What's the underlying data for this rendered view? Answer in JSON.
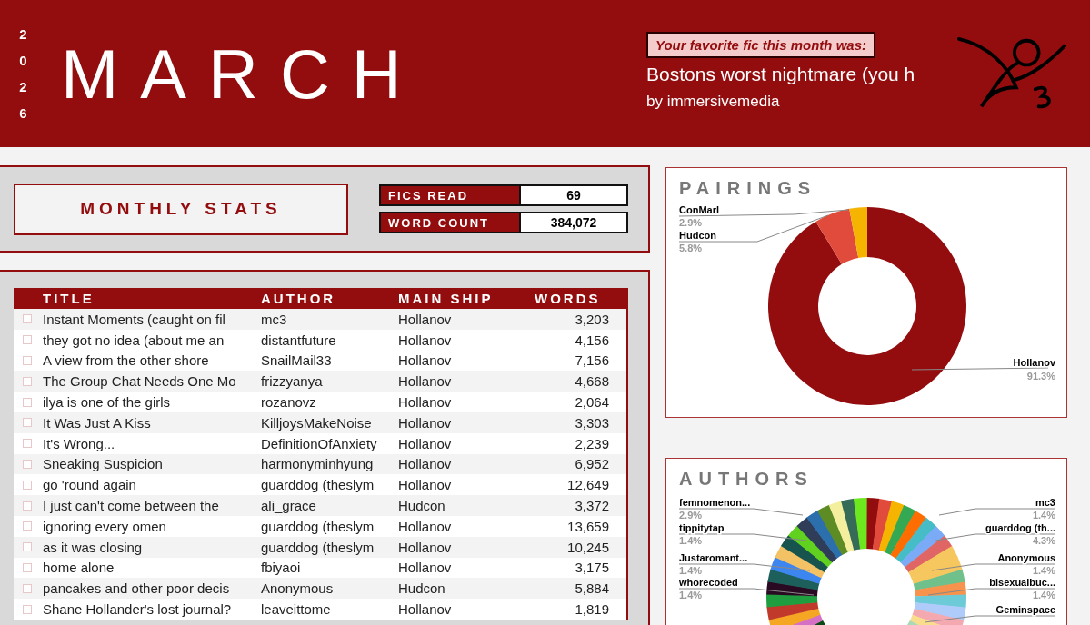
{
  "header": {
    "year": "2026",
    "month": "MARCH",
    "favorite": {
      "prompt": "Your favorite fic this month was:",
      "title": "Bostons worst nightmare (you h",
      "byline": "by immersivemedia"
    }
  },
  "stats": {
    "heading": "MONTHLY STATS",
    "items": [
      {
        "label": "FICS READ",
        "value": "69"
      },
      {
        "label": "WORD COUNT",
        "value": "384,072"
      }
    ]
  },
  "table": {
    "columns": [
      "TITLE",
      "AUTHOR",
      "MAIN SHIP",
      "WORDS"
    ],
    "rows": [
      {
        "checked": false,
        "title": "Instant Moments (caught on fil",
        "author": "mc3",
        "ship": "Hollanov",
        "words": "3,203"
      },
      {
        "checked": false,
        "title": "they got no idea (about me an",
        "author": "distantfuture",
        "ship": "Hollanov",
        "words": "4,156"
      },
      {
        "checked": false,
        "title": "A view from the other shore",
        "author": "SnailMail33",
        "ship": "Hollanov",
        "words": "7,156"
      },
      {
        "checked": false,
        "title": "The Group Chat Needs One Mo",
        "author": "frizzyanya",
        "ship": "Hollanov",
        "words": "4,668"
      },
      {
        "checked": false,
        "title": "ilya is one of the girls",
        "author": "rozanovz",
        "ship": "Hollanov",
        "words": "2,064"
      },
      {
        "checked": false,
        "title": "It Was Just A Kiss",
        "author": "KilljoysMakeNoise",
        "ship": "Hollanov",
        "words": "3,303"
      },
      {
        "checked": false,
        "title": "It's Wrong...",
        "author": "DefinitionOfAnxiety",
        "ship": "Hollanov",
        "words": "2,239"
      },
      {
        "checked": false,
        "title": "Sneaking Suspicion",
        "author": "harmonyminhyung",
        "ship": "Hollanov",
        "words": "6,952"
      },
      {
        "checked": false,
        "title": "go 'round again",
        "author": "guarddog (theslym",
        "ship": "Hollanov",
        "words": "12,649"
      },
      {
        "checked": false,
        "title": "I just can't come between the",
        "author": "ali_grace",
        "ship": "Hudcon",
        "words": "3,372"
      },
      {
        "checked": false,
        "title": "ignoring every omen",
        "author": "guarddog (theslym",
        "ship": "Hollanov",
        "words": "13,659"
      },
      {
        "checked": false,
        "title": "as it was closing",
        "author": "guarddog (theslym",
        "ship": "Hollanov",
        "words": "10,245"
      },
      {
        "checked": false,
        "title": "home alone",
        "author": "fbiyaoi",
        "ship": "Hollanov",
        "words": "3,175"
      },
      {
        "checked": false,
        "title": "pancakes and other poor decis",
        "author": "Anonymous",
        "ship": "Hudcon",
        "words": "5,884"
      },
      {
        "checked": false,
        "title": "Shane Hollander's lost journal?",
        "author": "leaveittome",
        "ship": "Hollanov",
        "words": "1,819"
      }
    ]
  },
  "pairings": {
    "chart_data": {
      "type": "donut",
      "title": "PAIRINGS",
      "categories": [
        "Hollanov",
        "Hudcon",
        "ConMarl"
      ],
      "values": [
        91.3,
        5.8,
        2.9
      ],
      "value_labels": [
        "91.3%",
        "5.8%",
        "2.9%"
      ]
    }
  },
  "authors": {
    "title": "AUTHORS",
    "left_labels": [
      {
        "name": "femnomenon...",
        "percent": "2.9%"
      },
      {
        "name": "tippitytap",
        "percent": "1.4%"
      },
      {
        "name": "Justaromant...",
        "percent": "1.4%"
      },
      {
        "name": "whorecoded",
        "percent": "1.4%"
      }
    ],
    "right_labels": [
      {
        "name": "mc3",
        "percent": "1.4%"
      },
      {
        "name": "guarddog (th...",
        "percent": "4.3%"
      },
      {
        "name": "Anonymous",
        "percent": "1.4%"
      },
      {
        "name": "bisexualbuc...",
        "percent": "1.4%"
      },
      {
        "name": "Geminspace"
      }
    ]
  }
}
